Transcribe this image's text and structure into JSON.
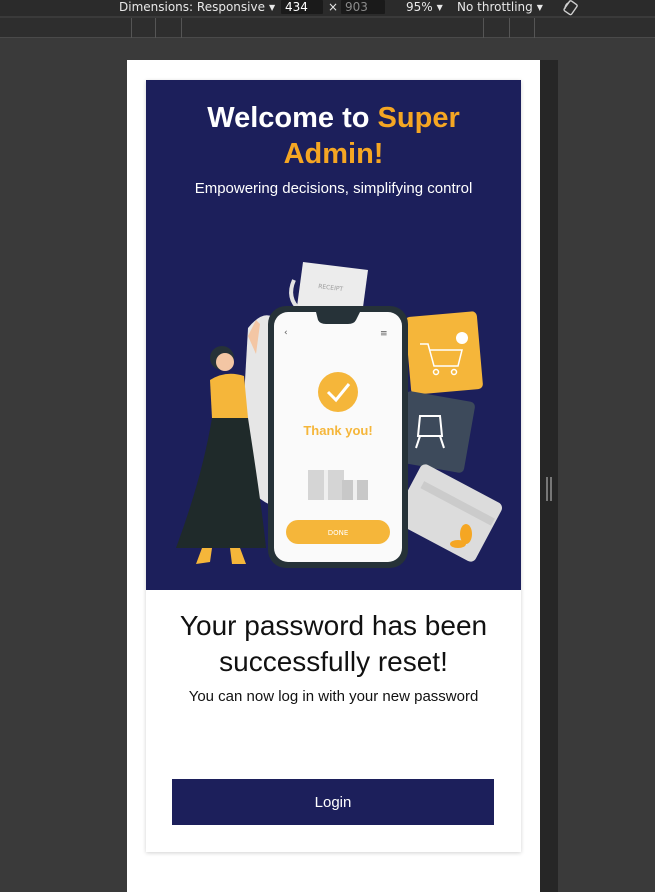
{
  "devtools": {
    "dimensions_label": "Dimensions: Responsive",
    "width_value": "434",
    "times_sign": "×",
    "height_value": "903",
    "zoom_label": "95%",
    "throttling_label": "No throttling",
    "caret": "▼"
  },
  "hero": {
    "title_prefix": "Welcome to ",
    "title_accent": "Super Admin!",
    "subtitle": "Empowering decisions, simplifying control"
  },
  "illustration": {
    "receipt_text": "RECEIPT",
    "thank_you": "Thank you!",
    "done_label": "DONE",
    "back_glyph": "‹",
    "menu_glyph": "≡"
  },
  "content": {
    "success_title": "Your password has been successfully reset!",
    "success_subtitle": "You can now log in with your new password",
    "login_label": "Login"
  },
  "colors": {
    "brand": "#1c1f5b",
    "accent": "#f5a623",
    "page_bg": "#3a3a3a"
  },
  "icons": [
    "rotate-icon",
    "caret-down-icon",
    "resize-handle-icon"
  ]
}
